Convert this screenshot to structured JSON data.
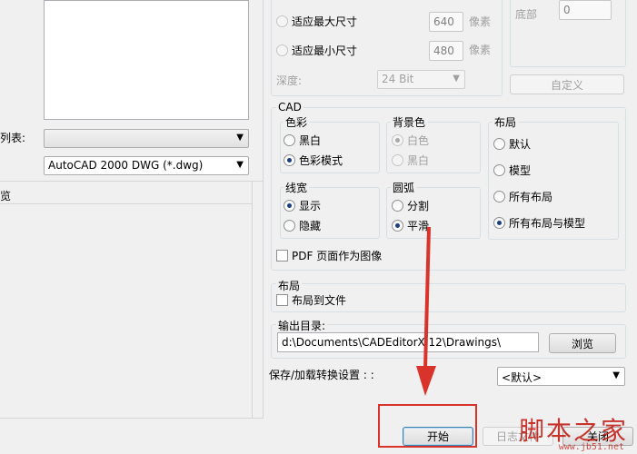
{
  "left_panel": {
    "list_label_partial": "列表:",
    "preview_label_partial": "览",
    "format_value": "AutoCAD 2000 DWG (*.dwg)",
    "list_combo_value": ""
  },
  "image_size": {
    "fit_max_label": "适应最大尺寸",
    "fit_max_value": "640",
    "fit_min_label": "适应最小尺寸",
    "fit_min_value": "480",
    "pixel_unit": "像素",
    "depth_label": "深度:",
    "depth_value": "24 Bit",
    "bottom_label": "底部",
    "bottom_value": "0",
    "custom_button": "自定义"
  },
  "cad": {
    "title": "CAD",
    "color": {
      "title": "色彩",
      "bw": "黑白",
      "color_mode": "色彩模式"
    },
    "background": {
      "title": "背景色",
      "white": "白色",
      "black": "黑白"
    },
    "layout": {
      "title": "布局",
      "default": "默认",
      "model": "模型",
      "all_layouts": "所有布局",
      "all_layouts_model": "所有布局与模型"
    },
    "lineweight": {
      "title": "线宽",
      "show": "显示",
      "hide": "隐藏"
    },
    "arc": {
      "title": "圆弧",
      "split": "分割",
      "smooth": "平滑"
    },
    "pdf_as_image": "PDF 页面作为图像"
  },
  "layout_section": {
    "title": "布局",
    "layout_to_file": "布局到文件"
  },
  "output": {
    "label": "输出目录:",
    "path": "d:\\Documents\\CADEditorX 12\\Drawings\\",
    "browse": "浏览"
  },
  "save_load": {
    "label": "保存/加载转换设置 : :",
    "value": "<默认>"
  },
  "footer": {
    "start": "开始",
    "log": "日志文件",
    "close": "关闭"
  },
  "watermark": {
    "site_cn": "脚本之家",
    "site_url": "www.jb51.net"
  },
  "colors": {
    "annotation_red": "#d9342b",
    "group_border": "#d5dfe5"
  }
}
